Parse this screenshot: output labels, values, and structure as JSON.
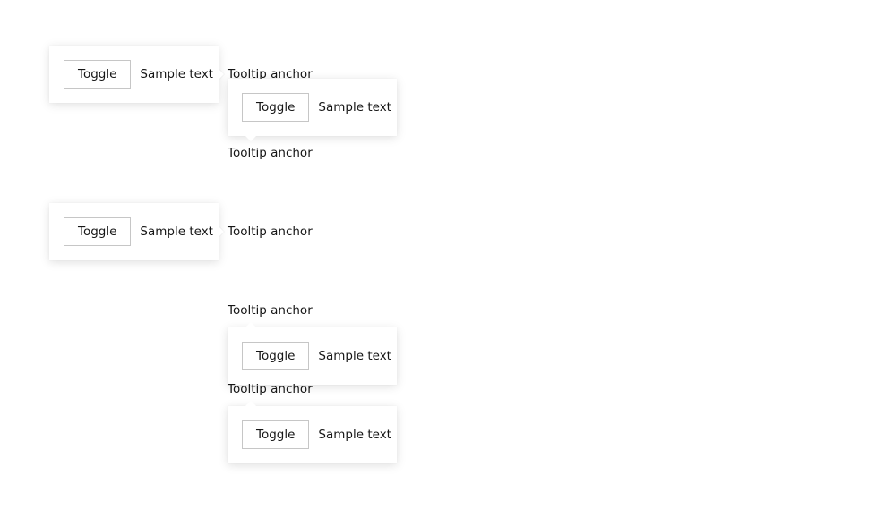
{
  "groups": [
    {
      "anchor": "Tooltip anchor",
      "toggle": "Toggle",
      "sample": "Sample text",
      "placement": "left"
    },
    {
      "anchor": "Tooltip anchor",
      "toggle": "Toggle",
      "sample": "Sample text",
      "placement": "top"
    },
    {
      "anchor": "Tooltip anchor",
      "toggle": "Toggle",
      "sample": "Sample text",
      "placement": "left"
    },
    {
      "anchor": "Tooltip anchor",
      "toggle": "Toggle",
      "sample": "Sample text",
      "placement": "bottom"
    },
    {
      "anchor": "Tooltip anchor",
      "toggle": "Toggle",
      "sample": "Sample text",
      "placement": "bottom"
    }
  ]
}
